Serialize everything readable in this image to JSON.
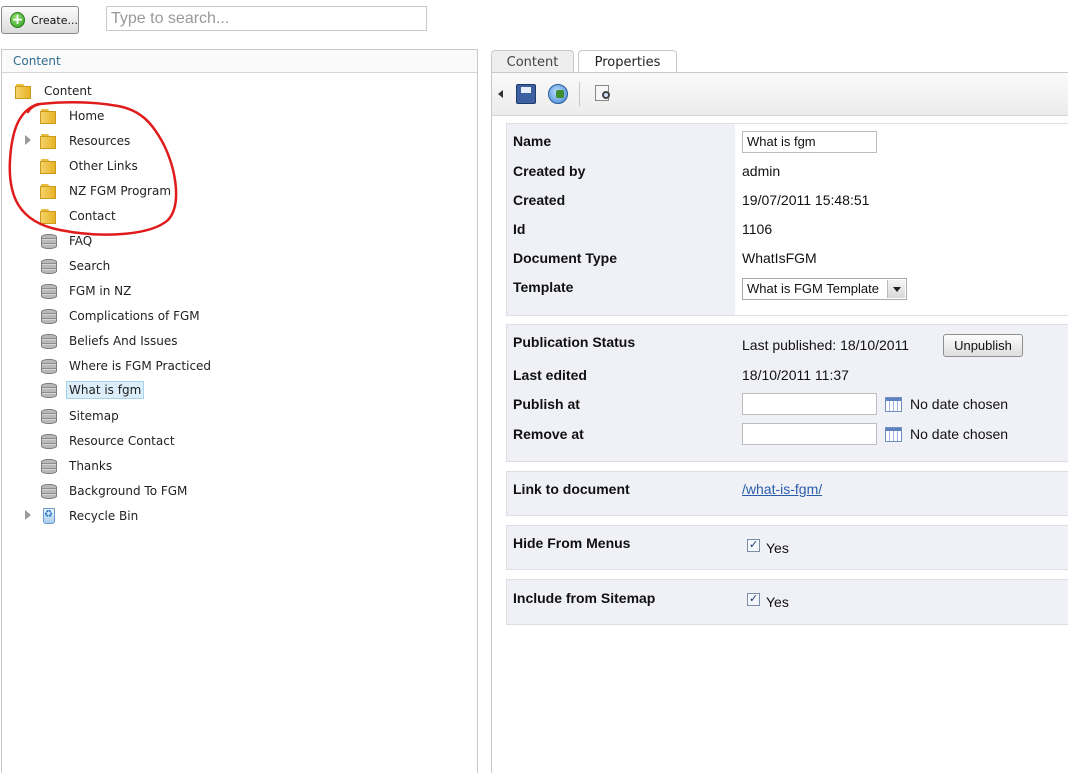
{
  "toolbar": {
    "create_label": "Create...",
    "search_placeholder": "Type to search..."
  },
  "left_panel": {
    "header": "Content",
    "tree": {
      "root": "Content",
      "items": [
        {
          "label": "Home",
          "type": "folder"
        },
        {
          "label": "Resources",
          "type": "folder"
        },
        {
          "label": "Other Links",
          "type": "folder"
        },
        {
          "label": "NZ FGM Program",
          "type": "folder"
        },
        {
          "label": "Contact",
          "type": "folder"
        },
        {
          "label": "FAQ",
          "type": "document"
        },
        {
          "label": "Search",
          "type": "document"
        },
        {
          "label": "FGM in NZ",
          "type": "document"
        },
        {
          "label": "Complications of FGM",
          "type": "document"
        },
        {
          "label": "Beliefs And Issues",
          "type": "document"
        },
        {
          "label": "Where is FGM Practiced",
          "type": "document"
        },
        {
          "label": "What is fgm",
          "type": "document",
          "selected": true
        },
        {
          "label": "Sitemap",
          "type": "document"
        },
        {
          "label": "Resource Contact",
          "type": "document"
        },
        {
          "label": "Thanks",
          "type": "document"
        },
        {
          "label": "Background To FGM",
          "type": "document"
        },
        {
          "label": "Recycle Bin",
          "type": "recycle-bin"
        }
      ]
    },
    "annotation_color": "#e01b1b"
  },
  "tabs": [
    {
      "label": "Content",
      "active": false
    },
    {
      "label": "Properties",
      "active": true
    }
  ],
  "properties": {
    "name_label": "Name",
    "name_value": "What is fgm",
    "created_by_label": "Created by",
    "created_by_value": "admin",
    "created_label": "Created",
    "created_value": "19/07/2011 15:48:51",
    "id_label": "Id",
    "id_value": "1106",
    "doctype_label": "Document Type",
    "doctype_value": "WhatIsFGM",
    "template_label": "Template",
    "template_value": "What is FGM Template",
    "pub_status_label": "Publication Status",
    "pub_status_value": "Last published: 18/10/2011",
    "unpublish_label": "Unpublish",
    "last_edited_label": "Last edited",
    "last_edited_value": "18/10/2011 11:37",
    "publish_at_label": "Publish at",
    "publish_at_hint": "No date chosen",
    "remove_at_label": "Remove at",
    "remove_at_hint": "No date chosen",
    "link_label": "Link to document",
    "link_value": "/what-is-fgm/",
    "hide_menus_label": "Hide From Menus",
    "hide_menus_value": "Yes",
    "include_sitemap_label": "Include from Sitemap",
    "include_sitemap_value": "Yes"
  }
}
